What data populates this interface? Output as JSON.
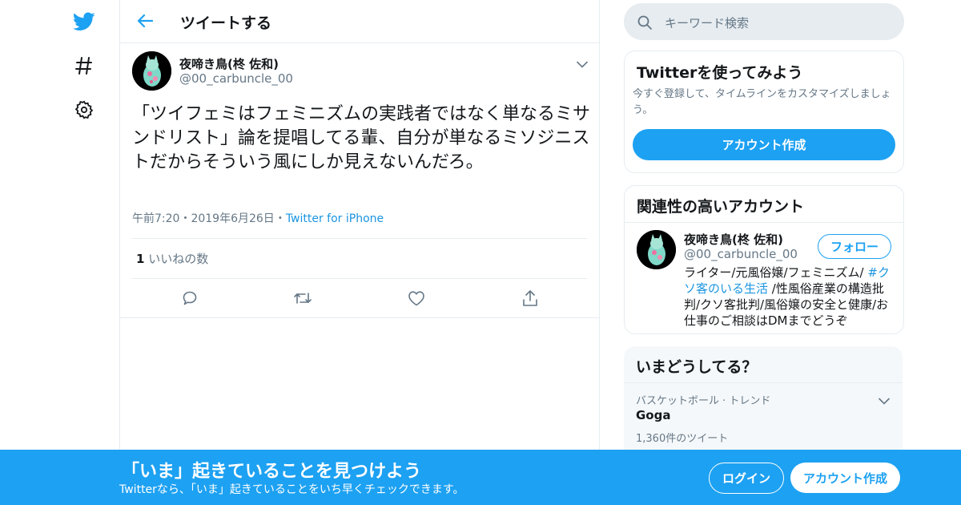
{
  "colors": {
    "accent": "#1da1f2",
    "link": "#1b95e0",
    "muted": "#657786",
    "text": "#14171a"
  },
  "nav": {
    "icons": [
      "twitter-logo-icon",
      "hashtag-icon",
      "gear-icon"
    ]
  },
  "header": {
    "title": "ツイートする"
  },
  "tweet": {
    "user_name": "夜啼き鳥(柊 佐和)",
    "handle": "@00_carbuncle_00",
    "text": "「ツイフェミはフェミニズムの実践者ではなく単なるミサンドリスト」論を提唱してる輩、自分が単なるミソジニストだからそういう風にしか見えないんだろ。",
    "time": "午前7:20",
    "date": "2019年6月26日",
    "source": "Twitter for iPhone",
    "likes_count": "1",
    "likes_label": "いいねの数",
    "separator": "・"
  },
  "search": {
    "placeholder": "キーワード検索"
  },
  "signup_card": {
    "title": "Twitterを使ってみよう",
    "description": "今すぐ登録して、タイムラインをカスタマイズしましょう。",
    "button": "アカウント作成"
  },
  "related": {
    "title": "関連性の高いアカウント",
    "name": "夜啼き鳥(柊 佐和)",
    "handle": "@00_carbuncle_00",
    "follow": "フォロー",
    "bio_prefix": "ライター/元風俗嬢/フェミニズム/ ",
    "bio_hashtag": "#クソ客のいる生活",
    "bio_suffix": " /性風俗産業の構造批判/クソ客批判/風俗嬢の安全と健康/お仕事のご相談はDMまでどうぞ"
  },
  "trends": {
    "title": "いまどうしてる？",
    "category": "バスケットボール · トレンド",
    "name": "Goga",
    "count": "1,360件のツイート"
  },
  "banner": {
    "title": "「いま」起きていることを見つけよう",
    "subtitle": "Twitterなら、「いま」起きていることをいち早くチェックできます。",
    "login": "ログイン",
    "signup": "アカウント作成"
  }
}
